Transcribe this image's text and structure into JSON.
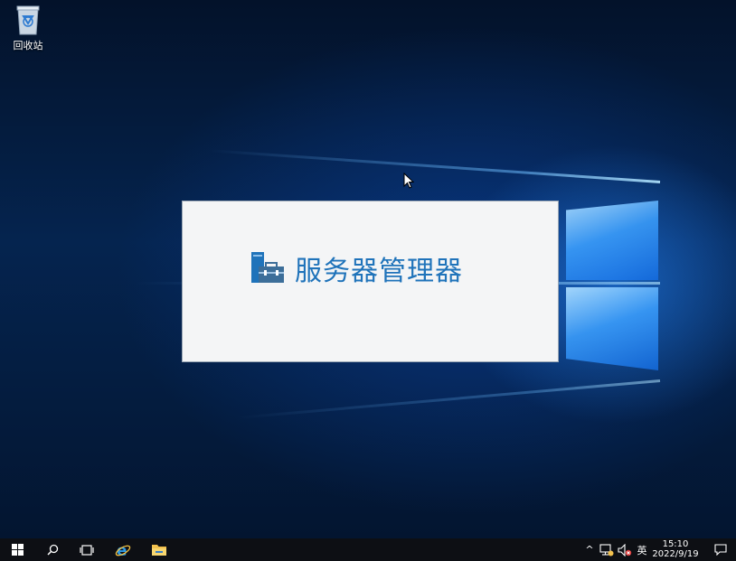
{
  "desktop": {
    "icons": [
      {
        "label": "回收站",
        "icon": "recycle-bin-icon"
      }
    ]
  },
  "splash": {
    "title": "服务器管理器",
    "icon": "server-manager-icon",
    "accent_color": "#1f73ba"
  },
  "taskbar": {
    "pinned": [
      {
        "name": "start",
        "icon": "windows-start-icon"
      },
      {
        "name": "search",
        "icon": "search-icon"
      },
      {
        "name": "task-view",
        "icon": "task-view-icon"
      },
      {
        "name": "internet-explorer",
        "icon": "internet-explorer-icon"
      },
      {
        "name": "file-explorer",
        "icon": "file-explorer-icon"
      }
    ],
    "tray": {
      "show_hidden": "^",
      "input_language": "英",
      "time": "15:10",
      "date": "2022/9/19"
    }
  }
}
